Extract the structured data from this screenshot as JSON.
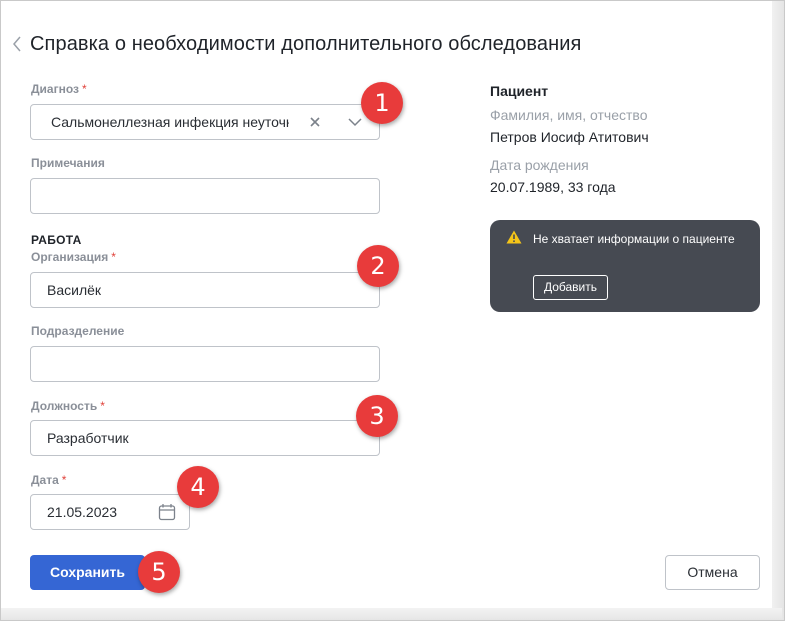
{
  "header": {
    "title": "Справка о необходимости дополнительного обследования"
  },
  "form": {
    "diagnosis": {
      "label": "Диагноз",
      "required_mark": "*",
      "value": "Сальмонеллезная",
      "value_rest": " инфекция неуточненн"
    },
    "notes": {
      "label": "Примечания",
      "value": ""
    },
    "work_section": "РАБОТА",
    "organization": {
      "label": "Организация",
      "required_mark": "*",
      "value": "Василёк"
    },
    "department": {
      "label": "Подразделение",
      "value": ""
    },
    "position": {
      "label": "Должность",
      "required_mark": "*",
      "value": "Разработчик"
    },
    "date": {
      "label": "Дата",
      "required_mark": "*",
      "value": "21.05.2023"
    }
  },
  "buttons": {
    "save": "Сохранить",
    "cancel": "Отмена"
  },
  "patient": {
    "heading": "Пациент",
    "name_label": "Фамилия, имя, отчество",
    "name": "Петров Иосиф Атитович",
    "birth_label": "Дата рождения",
    "birth": "20.07.1989, 33 года"
  },
  "alert": {
    "text": "Не хватает информации о пациенте",
    "button": "Добавить"
  },
  "annotations": [
    "1",
    "2",
    "3",
    "4",
    "5"
  ],
  "colors": {
    "primary": "#3566d4",
    "badge": "#e83b3b",
    "alert_bg": "#464a52",
    "warning": "#f5c518",
    "required": "#e0413a"
  }
}
